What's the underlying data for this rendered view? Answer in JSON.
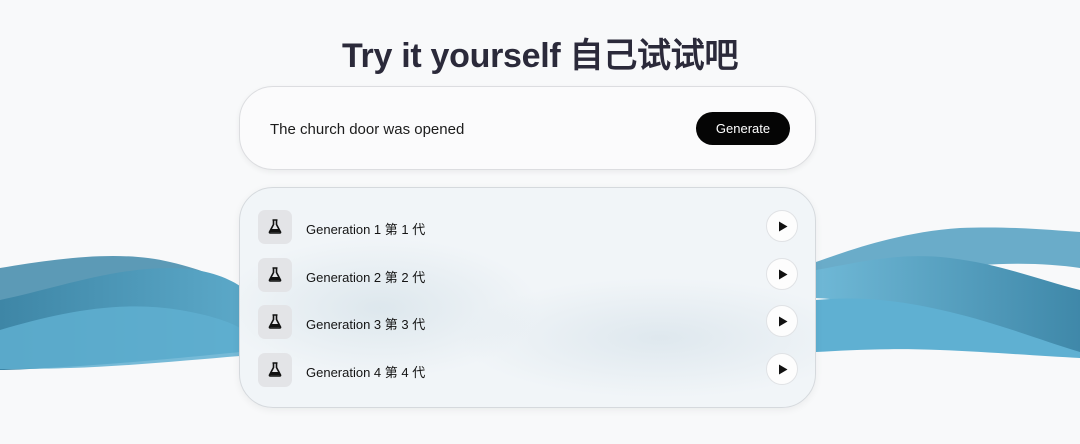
{
  "header": {
    "title": "Try it yourself 自己试试吧"
  },
  "prompt": {
    "value": "The church door was opened",
    "generate_label": "Generate"
  },
  "generations": [
    {
      "label": "Generation 1 第 1 代",
      "icon": "flask-icon",
      "action_icon": "play-icon"
    },
    {
      "label": "Generation 2 第 2 代",
      "icon": "flask-icon",
      "action_icon": "play-icon"
    },
    {
      "label": "Generation 3 第 3 代",
      "icon": "flask-icon",
      "action_icon": "play-icon"
    },
    {
      "label": "Generation 4 第 4 代",
      "icon": "flask-icon",
      "action_icon": "play-icon"
    }
  ],
  "colors": {
    "wave_dark": "#3d87a8",
    "wave_light": "#62b0d0",
    "title": "#2b2a3a",
    "button_bg": "#050505"
  }
}
